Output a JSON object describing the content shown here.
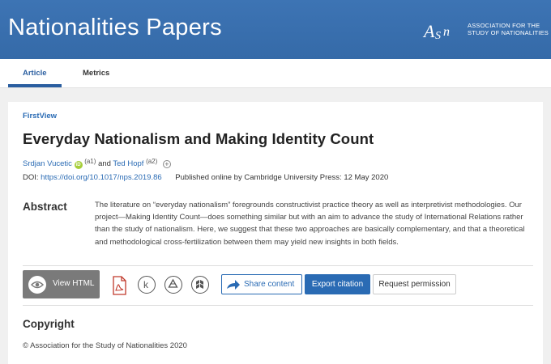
{
  "header": {
    "journal_title": "Nationalities Papers",
    "logo_mark": "ASN",
    "logo_line1": "ASSOCIATION FOR THE",
    "logo_line2": "STUDY OF NATIONALITIES",
    "color": "#3a6fad"
  },
  "tabs": [
    {
      "label": "Article",
      "active": true
    },
    {
      "label": "Metrics",
      "active": false
    }
  ],
  "article": {
    "section": "FirstView",
    "title": "Everyday Nationalism and Making Identity Count",
    "authors": [
      {
        "name": "Srdjan Vucetic",
        "affiliation": "(a1)",
        "orcid": true
      },
      {
        "name": "Ted Hopf",
        "affiliation": "(a2)",
        "orcid": false
      }
    ],
    "author_joiner": "and",
    "doi_label": "DOI:",
    "doi": "https://doi.org/10.1017/nps.2019.86",
    "published": "Published online by Cambridge University Press: 12 May 2020"
  },
  "abstract": {
    "heading": "Abstract",
    "text": "The literature on “everyday nationalism” foregrounds constructivist practice theory as well as interpretivist methodologies. Our project—Making Identity Count—does something similar but with an aim to advance the study of International Relations rather than the study of nationalism. Here, we suggest that these two approaches are basically complementary, and that a theoretical and methodological cross-fertilization between them may yield new insights in both fields."
  },
  "actions": {
    "view_html": "View HTML",
    "icons": [
      "pdf-icon",
      "kindle-icon",
      "google-drive-icon",
      "dropbox-icon"
    ],
    "share": "Share content",
    "export": "Export citation",
    "request": "Request permission"
  },
  "copyright": {
    "heading": "Copyright",
    "text": "© Association for the Study of Nationalities 2020"
  },
  "colors": {
    "link": "#2a6bb4",
    "accent": "#2a5ea0",
    "orcid": "#a6ce39"
  }
}
